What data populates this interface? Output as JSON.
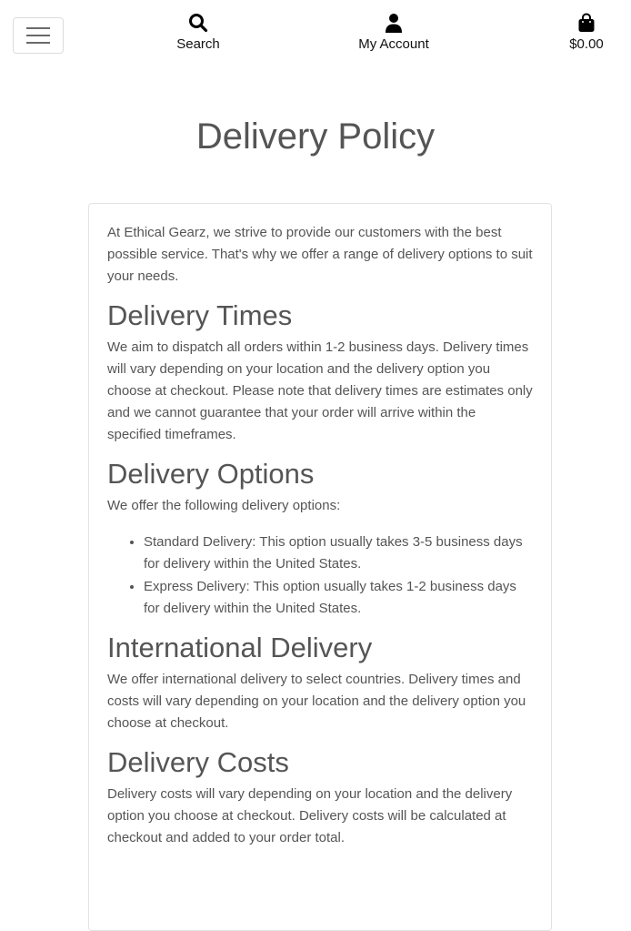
{
  "nav": {
    "search_label": "Search",
    "account_label": "My Account",
    "bag_total": "$0.00"
  },
  "page": {
    "title": "Delivery Policy"
  },
  "content": {
    "intro": "At Ethical Gearz, we strive to provide our customers with the best possible service. That's why we offer a range of delivery options to suit your needs.",
    "sections": [
      {
        "heading": "Delivery Times",
        "body": "We aim to dispatch all orders within 1-2 business days. Delivery times will vary depending on your location and the delivery option you choose at checkout. Please note that delivery times are estimates only and we cannot guarantee that your order will arrive within the specified timeframes."
      },
      {
        "heading": "Delivery Options",
        "body": "We offer the following delivery options:",
        "list": [
          "Standard Delivery: This option usually takes 3-5 business days for delivery within the United States.",
          "Express Delivery: This option usually takes 1-2 business days for delivery within the United States."
        ]
      },
      {
        "heading": "International Delivery",
        "body": "We offer international delivery to select countries. Delivery times and costs will vary depending on your location and the delivery option you choose at checkout."
      },
      {
        "heading": "Delivery Costs",
        "body": "Delivery costs will vary depending on your location and the delivery option you choose at checkout. Delivery costs will be calculated at checkout and added to your order total."
      }
    ]
  }
}
